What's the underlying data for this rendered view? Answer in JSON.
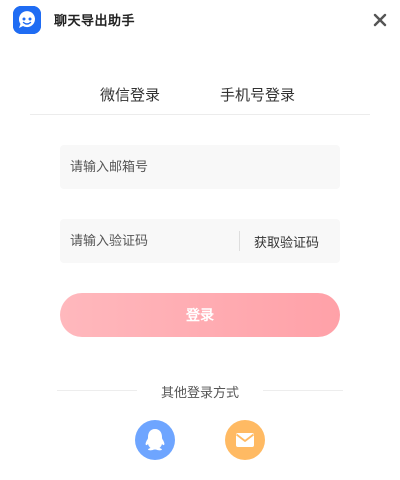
{
  "app": {
    "title": "聊天导出助手",
    "logo_icon": "chat-bubble-icon",
    "brand_color": "#1f6cf3"
  },
  "tabs": [
    {
      "label": "微信登录"
    },
    {
      "label": "手机号登录"
    }
  ],
  "form": {
    "email_placeholder": "请输入邮箱号",
    "code_placeholder": "请输入验证码",
    "get_code_label": "获取验证码",
    "login_label": "登录",
    "login_color": "#ffa8ae"
  },
  "other": {
    "label": "其他登录方式",
    "methods": [
      {
        "icon": "qq-penguin-icon",
        "color": "#6ea5ff"
      },
      {
        "icon": "mail-icon",
        "color": "#ffba63"
      }
    ]
  }
}
